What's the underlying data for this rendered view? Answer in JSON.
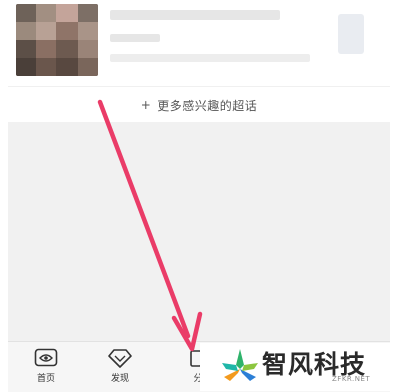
{
  "feed": {
    "more_link": "更多感兴趣的超话",
    "more_plus": "+"
  },
  "tabbar": {
    "tabs": [
      {
        "label": "首页",
        "icon": "home-eye-icon"
      },
      {
        "label": "发现",
        "icon": "diamond-discover-icon"
      },
      {
        "label": "分",
        "icon": "share-icon"
      }
    ]
  },
  "watermark": {
    "name": "智风科技",
    "url": "ZFKR.NET"
  },
  "colors": {
    "arrow": "#ea3c68",
    "logo_green": "#2fb36b",
    "logo_orange": "#f39a1e",
    "logo_blue": "#2c7fd6",
    "logo_teal": "#1fb6a8"
  }
}
